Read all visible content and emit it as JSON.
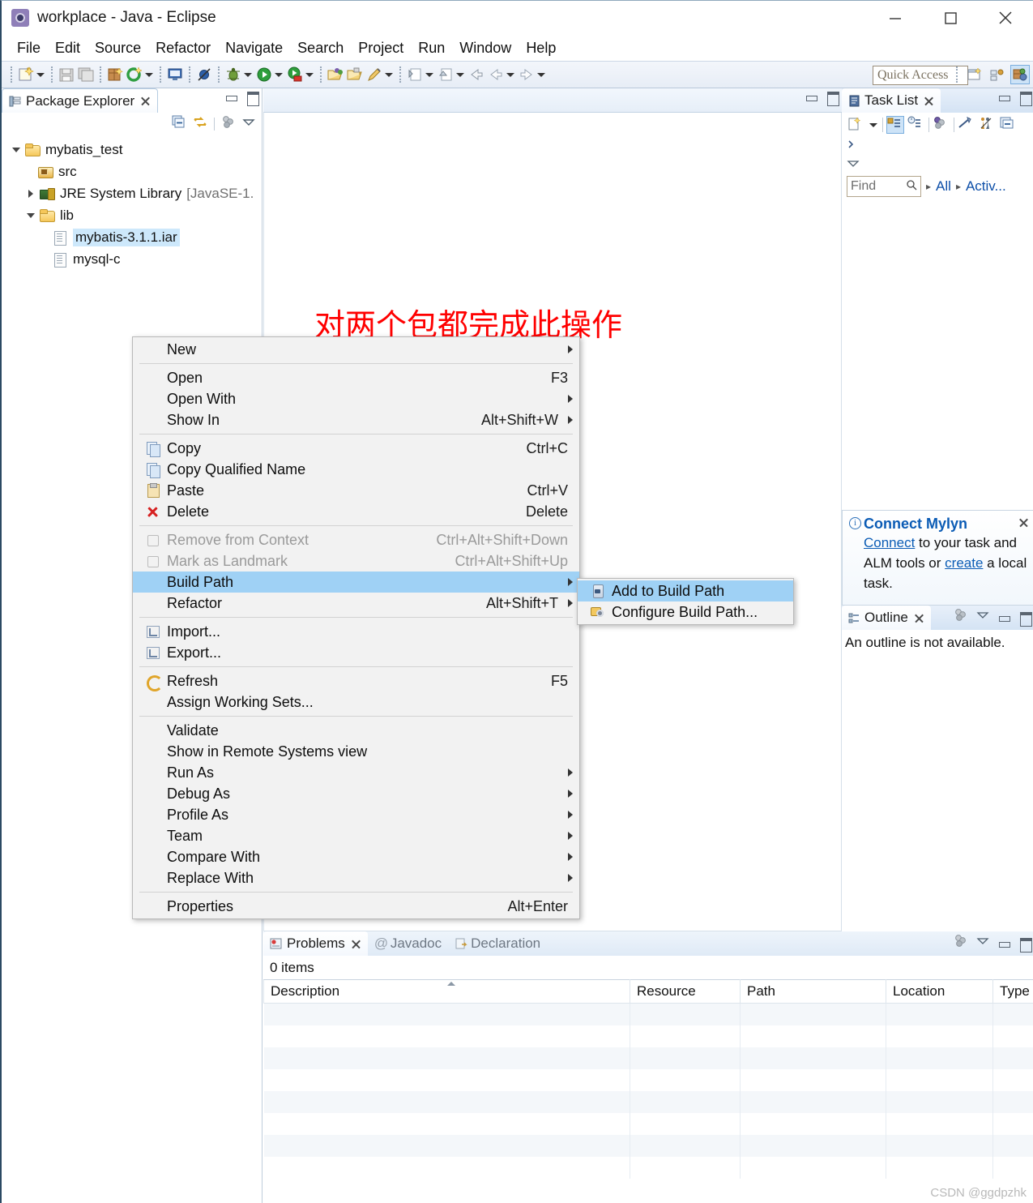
{
  "window": {
    "title": "workplace - Java - Eclipse",
    "app_icon": "eclipse-icon",
    "minimize": "minimize-button",
    "maximize": "maximize-button",
    "close": "close-button"
  },
  "menubar": {
    "items": [
      "File",
      "Edit",
      "Source",
      "Refactor",
      "Navigate",
      "Search",
      "Project",
      "Run",
      "Window",
      "Help"
    ]
  },
  "toolbar": {
    "quick_access_placeholder": "Quick Access",
    "icons": [
      "new-wizard-icon",
      "new-dropdown-icon",
      "save-icon",
      "save-all-icon",
      "new-java-package-icon",
      "refresh-build-icon",
      "build-dropdown-icon",
      "console-icon",
      "skip-breakpoints-icon",
      "debug-icon",
      "debug-dropdown-icon",
      "run-icon",
      "run-dropdown-icon",
      "coverage-icon",
      "coverage-dropdown-icon",
      "open-type-icon",
      "open-task-icon",
      "pencil-icon",
      "pencil-dropdown-icon",
      "next-annotation-icon",
      "next-dropdown-icon",
      "previous-annotation-icon",
      "previous-dropdown-icon",
      "back-icon",
      "back-arrow-icon",
      "back-dropdown-icon",
      "forward-icon",
      "forward-dropdown-icon"
    ],
    "perspective_icons": [
      "open-perspective-icon",
      "java-ee-perspective-icon",
      "java-perspective-icon"
    ]
  },
  "package_explorer": {
    "tab_label": "Package Explorer",
    "tree": [
      {
        "label": "mybatis_test",
        "icon": "java-project-icon",
        "twisty": "open",
        "indent": 0,
        "selected": false
      },
      {
        "label": "src",
        "icon": "source-folder-icon",
        "twisty": "none",
        "indent": 1,
        "selected": false
      },
      {
        "label": "JRE System Library",
        "suffix": "[JavaSE-1.",
        "icon": "jre-library-icon",
        "twisty": "closed",
        "indent": 1,
        "selected": false
      },
      {
        "label": "lib",
        "icon": "folder-icon",
        "twisty": "open",
        "indent": 1,
        "selected": false
      },
      {
        "label": "mybatis-3.1.1.iar",
        "icon": "jar-file-icon",
        "twisty": "none",
        "indent": 2,
        "selected": true
      },
      {
        "label": "mysql-c",
        "icon": "jar-file-icon",
        "twisty": "none",
        "indent": 2,
        "selected": false
      }
    ]
  },
  "annotation": {
    "text": "对两个包都完成此操作",
    "color": "#ff0000"
  },
  "context_menu": {
    "items": [
      {
        "label": "New",
        "accel": "",
        "icon": "",
        "submenu": true,
        "disabled": false,
        "highlighted": false
      },
      {
        "separator": true
      },
      {
        "label": "Open",
        "accel": "F3",
        "icon": "",
        "submenu": false,
        "disabled": false,
        "highlighted": false
      },
      {
        "label": "Open With",
        "accel": "",
        "icon": "",
        "submenu": true,
        "disabled": false,
        "highlighted": false
      },
      {
        "label": "Show In",
        "accel": "Alt+Shift+W",
        "icon": "",
        "submenu": true,
        "disabled": false,
        "highlighted": false
      },
      {
        "separator": true
      },
      {
        "label": "Copy",
        "accel": "Ctrl+C",
        "icon": "copy-icon",
        "submenu": false,
        "disabled": false,
        "highlighted": false
      },
      {
        "label": "Copy Qualified Name",
        "accel": "",
        "icon": "copy-qualified-icon",
        "submenu": false,
        "disabled": false,
        "highlighted": false
      },
      {
        "label": "Paste",
        "accel": "Ctrl+V",
        "icon": "paste-icon",
        "submenu": false,
        "disabled": false,
        "highlighted": false
      },
      {
        "label": "Delete",
        "accel": "Delete",
        "icon": "delete-icon",
        "submenu": false,
        "disabled": false,
        "highlighted": false
      },
      {
        "separator": true
      },
      {
        "label": "Remove from Context",
        "accel": "Ctrl+Alt+Shift+Down",
        "icon": "remove-context-icon",
        "submenu": false,
        "disabled": true,
        "highlighted": false
      },
      {
        "label": "Mark as Landmark",
        "accel": "Ctrl+Alt+Shift+Up",
        "icon": "landmark-icon",
        "submenu": false,
        "disabled": true,
        "highlighted": false
      },
      {
        "label": "Build Path",
        "accel": "",
        "icon": "",
        "submenu": true,
        "disabled": false,
        "highlighted": true
      },
      {
        "label": "Refactor",
        "accel": "Alt+Shift+T",
        "icon": "",
        "submenu": true,
        "disabled": false,
        "highlighted": false
      },
      {
        "separator": true
      },
      {
        "label": "Import...",
        "accel": "",
        "icon": "import-icon",
        "submenu": false,
        "disabled": false,
        "highlighted": false
      },
      {
        "label": "Export...",
        "accel": "",
        "icon": "export-icon",
        "submenu": false,
        "disabled": false,
        "highlighted": false
      },
      {
        "separator": true
      },
      {
        "label": "Refresh",
        "accel": "F5",
        "icon": "refresh-icon",
        "submenu": false,
        "disabled": false,
        "highlighted": false
      },
      {
        "label": "Assign Working Sets...",
        "accel": "",
        "icon": "",
        "submenu": false,
        "disabled": false,
        "highlighted": false
      },
      {
        "separator": true
      },
      {
        "label": "Validate",
        "accel": "",
        "icon": "",
        "submenu": false,
        "disabled": false,
        "highlighted": false
      },
      {
        "label": "Show in Remote Systems view",
        "accel": "",
        "icon": "",
        "submenu": false,
        "disabled": false,
        "highlighted": false
      },
      {
        "label": "Run As",
        "accel": "",
        "icon": "",
        "submenu": true,
        "disabled": false,
        "highlighted": false
      },
      {
        "label": "Debug As",
        "accel": "",
        "icon": "",
        "submenu": true,
        "disabled": false,
        "highlighted": false
      },
      {
        "label": "Profile As",
        "accel": "",
        "icon": "",
        "submenu": true,
        "disabled": false,
        "highlighted": false
      },
      {
        "label": "Team",
        "accel": "",
        "icon": "",
        "submenu": true,
        "disabled": false,
        "highlighted": false
      },
      {
        "label": "Compare With",
        "accel": "",
        "icon": "",
        "submenu": true,
        "disabled": false,
        "highlighted": false
      },
      {
        "label": "Replace With",
        "accel": "",
        "icon": "",
        "submenu": true,
        "disabled": false,
        "highlighted": false
      },
      {
        "separator": true
      },
      {
        "label": "Properties",
        "accel": "Alt+Enter",
        "icon": "",
        "submenu": false,
        "disabled": false,
        "highlighted": false
      }
    ]
  },
  "build_path_submenu": {
    "items": [
      {
        "label": "Add to Build Path",
        "icon": "jar-add-icon",
        "highlighted": true
      },
      {
        "label": "Configure Build Path...",
        "icon": "configure-build-path-icon",
        "highlighted": false
      }
    ]
  },
  "task_list": {
    "tab_label": "Task List",
    "find_placeholder": "Find",
    "filter_all": "All",
    "filter_active": "Activ...",
    "toolbar_icons": [
      "new-task-icon",
      "new-task-dropdown-icon",
      "categorized-mode-icon",
      "scheduled-mode-icon",
      "focus-on-workweek-icon",
      "collapse-all-icon",
      "presentation-icon",
      "link-with-editor-icon",
      "view-menu-icon"
    ]
  },
  "mylyn": {
    "title": "Connect Mylyn",
    "link_connect": "Connect",
    "text_mid": " to your task and ALM tools or ",
    "link_create": "create",
    "text_end": " a local task."
  },
  "outline": {
    "tab_label": "Outline",
    "message": "An outline is not available."
  },
  "problems": {
    "tabs": [
      {
        "label": "Problems",
        "icon": "problems-icon",
        "active": true
      },
      {
        "label": "Javadoc",
        "icon": "javadoc-icon",
        "active": false
      },
      {
        "label": "Declaration",
        "icon": "declaration-icon",
        "active": false
      }
    ],
    "items_count": "0 items",
    "columns": [
      "Description",
      "Resource",
      "Path",
      "Location",
      "Type"
    ],
    "rows": []
  },
  "watermark": "CSDN @ggdpzhk"
}
